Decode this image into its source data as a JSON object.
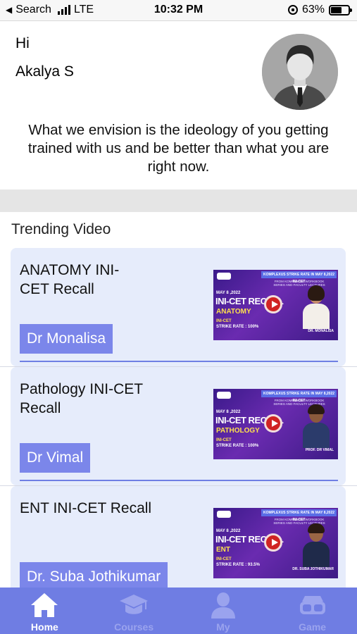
{
  "status_bar": {
    "back_label": "Search",
    "carrier": "LTE",
    "time": "10:32 PM",
    "battery_percent": "63%",
    "battery_level": 0.63
  },
  "greeting": {
    "hi": "Hi",
    "name": "Akalya S",
    "tagline": "What we envision is the ideology of you getting trained with us and be better than what you are right now."
  },
  "trending": {
    "title": "Trending Video",
    "videos": [
      {
        "title": "ANATOMY INI-CET Recall",
        "author": "Dr Monalisa",
        "thumb": {
          "banner": "KOMPLEXUS STRIKE RATE IN MAY 8,2022 INI-CET",
          "sub": "FROM KOMPLEXUS WORKBOOK SERIES AND FACULTY LECTURES",
          "date": "MAY 8 ,2022",
          "recall": "INI-CET RECALL",
          "subject": "ANATOMY",
          "ini": "INI-CET",
          "strike": "STRIKE RATE : 100%",
          "faculty": "DR. MONALISA"
        }
      },
      {
        "title": "Pathology INI-CET Recall",
        "author": "Dr Vimal",
        "thumb": {
          "banner": "KOMPLEXUS STRIKE RATE IN MAY 8,2022 INI-CET",
          "sub": "FROM KOMPLEXUS WORKBOOK SERIES AND FACULTY LECTURES",
          "date": "MAY 8 ,2022",
          "recall": "INI-CET RECALL",
          "subject": "PATHOLOGY",
          "ini": "INI-CET",
          "strike": "STRIKE RATE : 100%",
          "faculty": "PROF. DR VIMAL"
        }
      },
      {
        "title": "ENT INI-CET Recall",
        "author": "Dr. Suba Jothikumar",
        "thumb": {
          "banner": "KOMPLEXUS STRIKE RATE IN MAY 8,2022 INI-CET",
          "sub": "FROM KOMPLEXUS WORKBOOK SERIES AND FACULTY LECTURES",
          "date": "MAY 8 ,2022",
          "recall": "INI-CET RECALL",
          "subject": "ENT",
          "ini": "INI-CET",
          "strike": "STRIKE RATE : 93.5%",
          "faculty": "DR. SUBA JOTHIKUMAR"
        }
      }
    ]
  },
  "tabs": [
    {
      "label": "Home",
      "icon": "home-icon",
      "active": true
    },
    {
      "label": "Courses",
      "icon": "graduation-cap-icon",
      "active": false
    },
    {
      "label": "My",
      "icon": "user-icon",
      "active": false
    },
    {
      "label": "Game",
      "icon": "vr-headset-icon",
      "active": false
    }
  ],
  "colors": {
    "accent": "#6f7de3",
    "badge": "#7b86ea",
    "card_bg": "#e6ecfb",
    "tab_inactive": "#9aa3ee"
  }
}
